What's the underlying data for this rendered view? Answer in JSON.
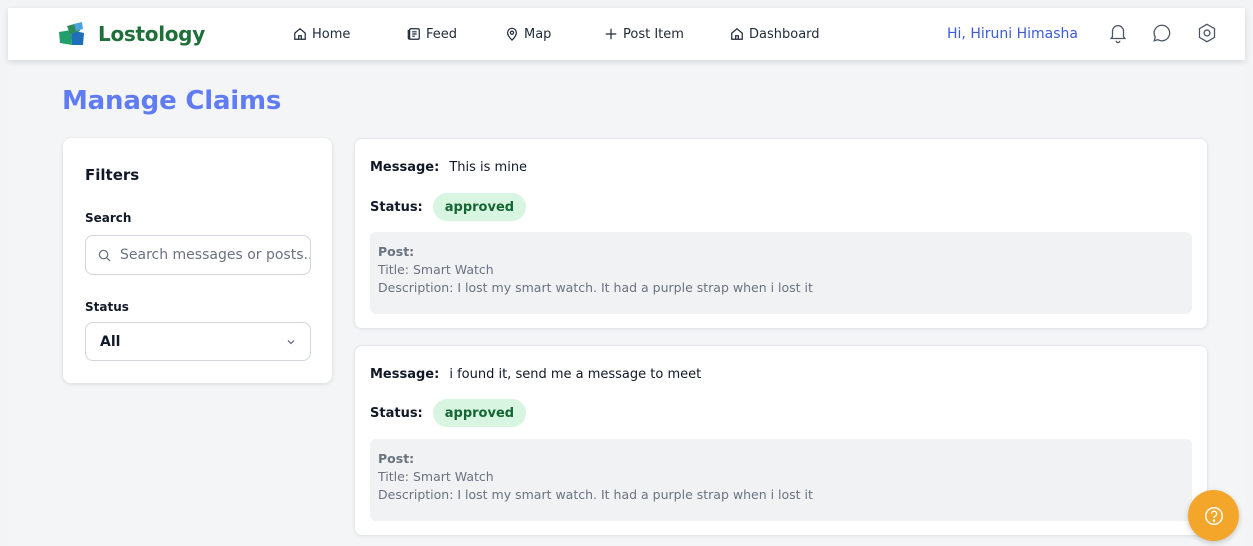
{
  "brand": {
    "name": "Lostology"
  },
  "nav": {
    "home": "Home",
    "feed": "Feed",
    "map": "Map",
    "post_item": "Post Item",
    "dashboard": "Dashboard",
    "greeting": "Hi, Hiruni Himasha",
    "icons": [
      "bell-icon",
      "chat-icon",
      "settings-icon"
    ]
  },
  "page": {
    "title": "Manage Claims"
  },
  "filters": {
    "title": "Filters",
    "search_label": "Search",
    "search_placeholder": "Search messages or posts..",
    "status_label": "Status",
    "status_value": "All"
  },
  "claims": [
    {
      "message_label": "Message:",
      "message": "This is mine",
      "status_label": "Status:",
      "status": "approved",
      "post_label": "Post:",
      "title_line": "Title: Smart Watch",
      "description_line": "Description: I lost my smart watch. It had a purple strap when i lost it"
    },
    {
      "message_label": "Message:",
      "message": "i found it, send me a message to meet",
      "status_label": "Status:",
      "status": "approved",
      "post_label": "Post:",
      "title_line": "Title: Smart Watch",
      "description_line": "Description: I lost my smart watch. It had a purple strap when i lost it"
    }
  ],
  "colors": {
    "accent": "#5f7cf2",
    "brand": "#1f6f3a",
    "greeting": "#3b5bdb",
    "approved_bg": "#d7f5e1",
    "approved_text": "#166534",
    "help_fab": "#f4a62a"
  }
}
